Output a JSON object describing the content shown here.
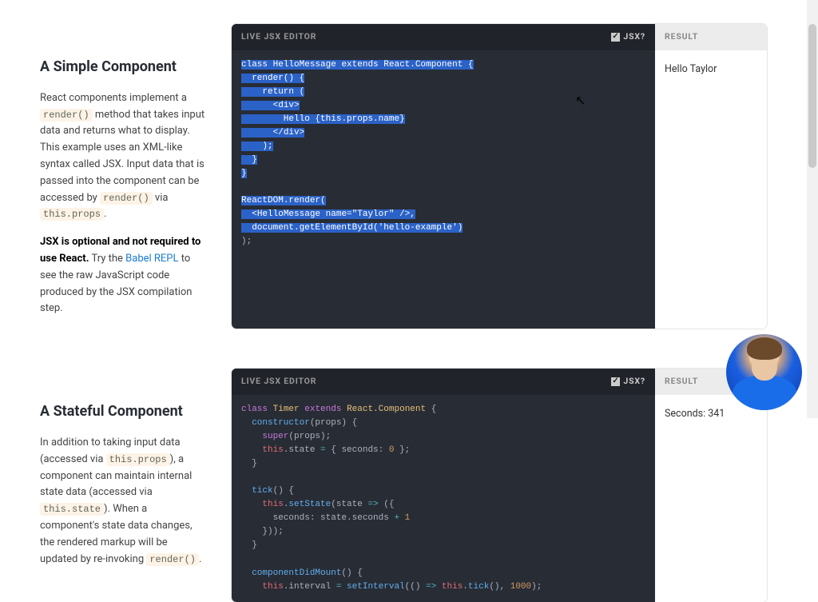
{
  "examples": [
    {
      "title": "A Simple Component",
      "desc1_parts": [
        "React components implement a ",
        "render()",
        " method that takes input data and returns what to display. This example uses an XML-like syntax called JSX. Input data that is passed into the component can be accessed by ",
        "render()",
        " via ",
        "this.props",
        "."
      ],
      "desc2_strong": "JSX is optional and not required to use React.",
      "desc2_rest": " Try the ",
      "desc2_link": "Babel REPL",
      "desc2_tail": " to see the raw JavaScript code produced by the JSX compilation step.",
      "editor_label": "LIVE JSX EDITOR",
      "jsx_label": "JSX?",
      "result_label": "RESULT",
      "result_text": "Hello Taylor",
      "code": {
        "l1": "class HelloMessage extends React.Component {",
        "l2": "  render() {",
        "l3": "    return (",
        "l4": "      <div>",
        "l5": "        Hello {this.props.name}",
        "l6": "      </div>",
        "l7": "    );",
        "l8": "  }",
        "l9": "}",
        "l10": "",
        "l11": "ReactDOM.render(",
        "l12": "  <HelloMessage name=\"Taylor\" />,",
        "l13": "  document.getElementById('hello-example')",
        "l14": ");"
      }
    },
    {
      "title": "A Stateful Component",
      "desc_parts": [
        "In addition to taking input data (accessed via ",
        "this.props",
        "), a component can maintain internal state data (accessed via ",
        "this.state",
        "). When a component's state data changes, the rendered markup will be updated by re-invoking ",
        "render()",
        "."
      ],
      "editor_label": "LIVE JSX EDITOR",
      "jsx_label": "JSX?",
      "result_label": "RESULT",
      "result_text": "Seconds: 341",
      "code": {
        "l1": "class Timer extends React.Component {",
        "l2": "  constructor(props) {",
        "l3": "    super(props);",
        "l4": "    this.state = { seconds: 0 };",
        "l5": "  }",
        "l6": "",
        "l7": "  tick() {",
        "l8": "    this.setState(state => ({",
        "l9": "      seconds: state.seconds + 1",
        "l10": "    }));",
        "l11": "  }",
        "l12": "",
        "l13": "  componentDidMount() {",
        "l14": "    this.interval = setInterval(() => this.tick(), 1000);"
      }
    }
  ]
}
